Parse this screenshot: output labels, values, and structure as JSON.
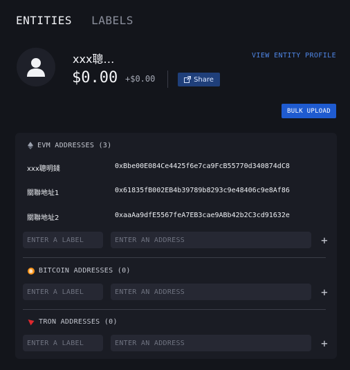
{
  "tabs": [
    {
      "label": "ENTITIES",
      "active": true
    },
    {
      "label": "LABELS",
      "active": false
    }
  ],
  "entity": {
    "name": "xxx聰…",
    "balance": "$0.00",
    "delta": "+$0.00",
    "share_label": "Share",
    "view_profile_label": "VIEW ENTITY PROFILE",
    "avatar_icon": "user-icon"
  },
  "bulk_upload_label": "BULK UPLOAD",
  "sections": {
    "evm": {
      "title": "EVM ADDRESSES (3)",
      "icon": "ethereum-icon",
      "rows": [
        {
          "label": "xxx聰明錢",
          "address": "0xBbe00E084Ce4425f6e7ca9FcB55770d340874dC8"
        },
        {
          "label": "關聯地址1",
          "address": "0x61835fB002EB4b39789b8293c9e48406c9e8Af86"
        },
        {
          "label": "關聯地址2",
          "address": "0xaaAa9dfE5567feA7EB3cae9ABb42b2C3cd91632e"
        }
      ]
    },
    "bitcoin": {
      "title": "BITCOIN ADDRESSES (0)",
      "icon": "bitcoin-icon"
    },
    "tron": {
      "title": "TRON ADDRESSES (0)",
      "icon": "tron-icon"
    }
  },
  "inputs": {
    "label_placeholder": "ENTER A LABEL",
    "address_placeholder": "ENTER AN ADDRESS"
  },
  "colors": {
    "background": "#13151b",
    "panel": "#1a1c24",
    "accent": "#1f5bd0",
    "link": "#4f86e6",
    "bitcoin": "#f7931a",
    "tron": "#e0282e"
  }
}
